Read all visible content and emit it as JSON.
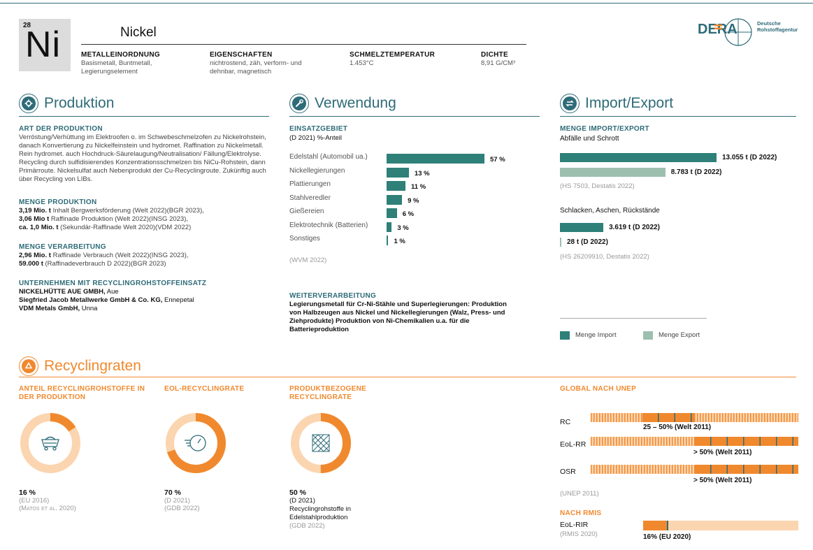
{
  "colors": {
    "teal": "#2e6b78",
    "bar_teal": "#2e8078",
    "light_teal": "#9dbfb0",
    "orange": "#f0892e",
    "light_orange": "#fbd5b0"
  },
  "element": {
    "number": "28",
    "symbol": "Ni",
    "name": "Nickel",
    "properties": [
      {
        "heading": "METALLEINORDNUNG",
        "value": "Basismetall, Buntmetall, Legierungselement"
      },
      {
        "heading": "EIGENSCHAFTEN",
        "value": "nichtrostend, zäh, verform- und dehnbar, magnetisch"
      },
      {
        "heading": "SCHMELZTEMPERATUR",
        "value": "1.453°C"
      },
      {
        "heading": "DICHTE",
        "value": "8,91 G/CM³"
      }
    ]
  },
  "logo": {
    "mark": "DERA",
    "line1": "Deutsche",
    "line2": "Rohstoffagentur"
  },
  "produktion": {
    "title": "Produktion",
    "icon": "gear-icon",
    "art_heading": "ART DER PRODUKTION",
    "art_text": "Verröstung/Verhüttung im Elektroofen o. im Schwebeschmelzofen zu Nickelrohstein, danach Konvertierung zu Nickelfeinstein und hydromet. Raffination zu Nickelmetall. Rein hydromet. auch Hochdruck-Säurelaugung/Neutralisation/ Fällung/Elektrolyse. Recycling durch sulfidisierendes Konzentrationsschmelzen bis NiCu-Rohstein, dann Primärroute. Nickelsulfat auch Nebenprodukt der Cu-Recyclingroute. Zukünftig auch über Recycling von LIBs.",
    "menge_heading": "MENGE PRODUKTION",
    "menge_lines": [
      {
        "bold": "3,19 Mio. t",
        "text": " Inhalt Bergwerksförderung (Welt 2022)(BGR 2023),"
      },
      {
        "bold": "3,06 Mio t",
        "text": " Raffinade Produktion (Welt 2022)(INSG 2023),"
      },
      {
        "bold": "ca. 1,0 Mio. t",
        "text": " (Sekundär-Raffinade Welt 2020)(VDM 2022)"
      }
    ],
    "verarb_heading": "MENGE VERARBEITUNG",
    "verarb_lines": [
      {
        "bold": "2,96 Mio. t",
        "text": " Raffinade Verbrauch (Welt 2022)(INSG 2023),"
      },
      {
        "bold": "59.000 t",
        "text": " (Raffinadeverbrauch D 2022)(BGR 2023)"
      }
    ],
    "unternehmen_heading": "UNTERNEHMEN MIT RECYCLINGROHSTOFFEINSATZ",
    "unternehmen_lines": [
      {
        "bold": "NICKELHÜTTE AUE GMBH,",
        "text": " Aue"
      },
      {
        "bold": "Siegfried Jacob Metallwerke GmbH & Co. KG,",
        "text": " Ennepetal"
      },
      {
        "bold": "VDM Metals GmbH,",
        "text": " Unna"
      }
    ]
  },
  "verwendung": {
    "title": "Verwendung",
    "icon": "wrench-icon",
    "heading": "EINSATZGEBIET",
    "subheading": "(D 2021) %-Anteil",
    "source": "(WVM 2022)",
    "weiter_heading": "WEITERVERARBEITUNG",
    "weiter_text": "Legierungsmetall für Cr-Ni-Stähle und Superlegierungen: Produktion von Halbzeugen aus Nickel und Nickellegierungen (Walz, Press- und Ziehprodukte) Produktion von Ni-Chemikalien u.a. für die Batterieproduktion"
  },
  "chart_data": [
    {
      "type": "bar",
      "title": "EINSATZGEBIET",
      "subtitle": "(D 2021) %-Anteil",
      "categories": [
        "Edelstahl (Automobil ua.)",
        "Nickellegierungen",
        "Plattierungen",
        "Stahlveredler",
        "Gießereien",
        "Elektrotechnik (Batterien)",
        "Sonstiges"
      ],
      "values": [
        57,
        13,
        11,
        9,
        6,
        3,
        1
      ],
      "labels": [
        "57 %",
        "13 %",
        "11 %",
        "9 %",
        "6 %",
        "3 %",
        "1 %"
      ],
      "orientation": "horizontal"
    },
    {
      "type": "bar",
      "title": "Abfälle und Schrott",
      "series": [
        {
          "name": "Menge Import",
          "values": [
            13055
          ]
        },
        {
          "name": "Menge Export",
          "values": [
            8783
          ]
        }
      ],
      "labels": [
        "13.055 t (D 2022)",
        "8.783 t (D 2022)"
      ],
      "orientation": "horizontal"
    },
    {
      "type": "bar",
      "title": "Schlacken, Aschen, Rückstände",
      "series": [
        {
          "name": "Menge Import",
          "values": [
            3619
          ]
        },
        {
          "name": "Menge Export",
          "values": [
            28
          ]
        }
      ],
      "labels": [
        "3.619 t (D 2022)",
        "28 t (D 2022)"
      ],
      "orientation": "horizontal"
    }
  ],
  "importexport": {
    "title": "Import/Export",
    "icon": "exchange-icon",
    "heading": "MENGE IMPORT/EXPORT",
    "group1_title": "Abfälle und Schrott",
    "group1_source": "(HS 7503, Destatis 2022)",
    "group2_title": "Schlacken, Aschen, Rückstände",
    "group2_source": "(HS 26209910, Destatis 2022)",
    "legend_import": "Menge Import",
    "legend_export": "Menge Export"
  },
  "recycling": {
    "title": "Recyclingraten",
    "icon": "recycle-icon",
    "anteil": {
      "heading": "ANTEIL RECYCLINGROHSTOFFE IN DER PRODUKTION",
      "value": "16 %",
      "fraction": 0.16,
      "icon": "mine-cart-icon",
      "src1": "(EU 2016)",
      "src2": "(Matos et al. 2020)"
    },
    "eol": {
      "heading": "EOL-RECYCLINGRATE",
      "value": "70 %",
      "fraction": 0.7,
      "icon": "stopwatch-icon",
      "src1": "(D 2021)",
      "src2": "(GDB 2022)"
    },
    "produkt": {
      "heading": "PRODUKTBEZOGENE RECYCLINGRATE",
      "value": "50 %",
      "fraction": 0.5,
      "icon": "steel-plate-icon",
      "src1": "(D 2021)",
      "note": "Recyclingrohstoffe in Edelstahlproduktion",
      "src2": "(GDB 2022)"
    },
    "unep": {
      "heading": "GLOBAL NACH UNEP",
      "rows": [
        {
          "label": "RC",
          "value": "25 – 50% (Welt 2011)",
          "from": 0.25,
          "to": 0.5
        },
        {
          "label": "EoL-RR",
          "value": "> 50% (Welt 2011)",
          "from": 0.5,
          "to": 1.0
        },
        {
          "label": "OSR",
          "value": "> 50% (Welt 2011)",
          "from": 0.5,
          "to": 1.0
        }
      ],
      "source": "(UNEP 2011)"
    },
    "rmis": {
      "heading": "NACH RMIS",
      "label": "EoL-RIR",
      "source": "(RMIS 2020)",
      "value": "16% (EU 2020)",
      "fraction": 0.16
    }
  }
}
